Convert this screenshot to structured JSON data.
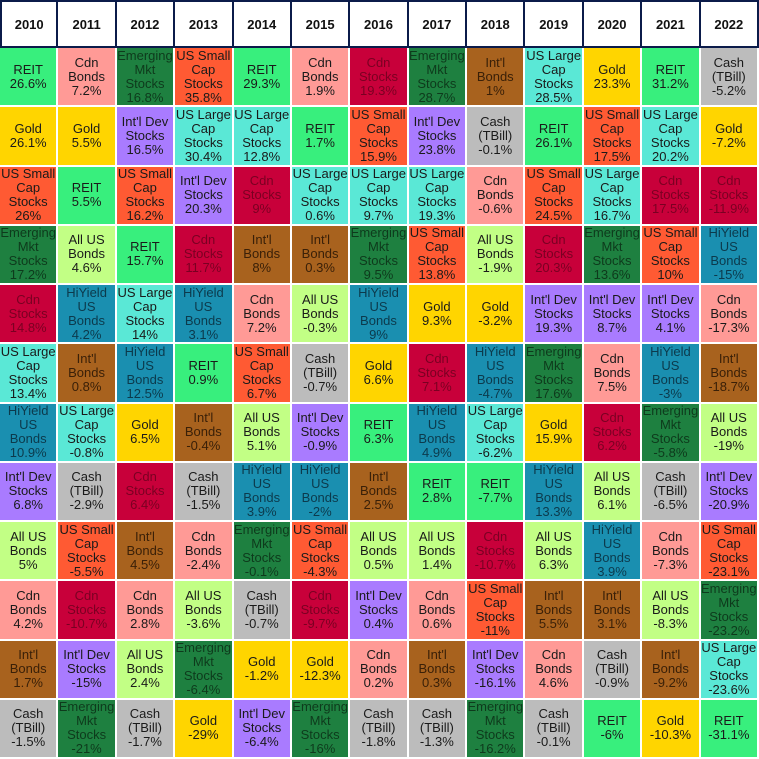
{
  "chart_data": {
    "type": "table",
    "title": "",
    "years": [
      "2010",
      "2011",
      "2012",
      "2013",
      "2014",
      "2015",
      "2016",
      "2017",
      "2018",
      "2019",
      "2020",
      "2021",
      "2022"
    ],
    "asset_colors": {
      "REIT": "#38ef7d",
      "Cdn Bonds": "#ff9a96",
      "Emerging Mkt Stocks": "#1e8040",
      "US Small Cap Stocks": "#ff5a33",
      "Cdn Stocks": "#c8003a",
      "Int'l Bonds": "#a8621e",
      "Gold": "#ffd500",
      "Int'l Dev Stocks": "#a97bff",
      "US Large Cap Stocks": "#5ae8d6",
      "Cash (TBill)": "#bcbcbc",
      "All US Bonds": "#c2ff85",
      "HiYield US Bonds": "#1a8fb0"
    },
    "asset_labels": {
      "REIT": "REIT",
      "Cdn Bonds": "Cdn\nBonds",
      "Emerging Mkt Stocks": "Emerging\nMkt\nStocks",
      "US Small Cap Stocks": "US Small\nCap\nStocks",
      "Cdn Stocks": "Cdn\nStocks",
      "Int'l Bonds": "Int'l\nBonds",
      "Gold": "Gold",
      "Int'l Dev Stocks": "Int'l Dev\nStocks",
      "US Large Cap Stocks": "US Large\nCap\nStocks",
      "Cash (TBill)": "Cash\n(TBill)",
      "All US Bonds": "All US\nBonds",
      "HiYield US Bonds": "HiYield\nUS\nBonds"
    },
    "columns": [
      {
        "year": "2010",
        "cells": [
          [
            "REIT",
            "26.6%"
          ],
          [
            "Gold",
            "26.1%"
          ],
          [
            "US Small Cap Stocks",
            "26%"
          ],
          [
            "Emerging Mkt Stocks",
            "17.2%"
          ],
          [
            "Cdn Stocks",
            "14.8%"
          ],
          [
            "US Large Cap Stocks",
            "13.4%"
          ],
          [
            "HiYield US Bonds",
            "10.9%"
          ],
          [
            "Int'l Dev Stocks",
            "6.8%"
          ],
          [
            "All US Bonds",
            "5%"
          ],
          [
            "Cdn Bonds",
            "4.2%"
          ],
          [
            "Int'l Bonds",
            "1.7%"
          ],
          [
            "Cash (TBill)",
            "-1.5%"
          ]
        ]
      },
      {
        "year": "2011",
        "cells": [
          [
            "Cdn Bonds",
            "7.2%"
          ],
          [
            "Gold",
            "5.5%"
          ],
          [
            "REIT",
            "5.5%"
          ],
          [
            "All US Bonds",
            "4.6%"
          ],
          [
            "HiYield US Bonds",
            "4.2%"
          ],
          [
            "Int'l Bonds",
            "0.8%"
          ],
          [
            "US Large Cap Stocks",
            "-0.8%"
          ],
          [
            "Cash (TBill)",
            "-2.9%"
          ],
          [
            "US Small Cap Stocks",
            "-5.5%"
          ],
          [
            "Cdn Stocks",
            "-10.7%"
          ],
          [
            "Int'l Dev Stocks",
            "-15%"
          ],
          [
            "Emerging Mkt Stocks",
            "-21%"
          ]
        ]
      },
      {
        "year": "2012",
        "cells": [
          [
            "Emerging Mkt Stocks",
            "16.8%"
          ],
          [
            "Int'l Dev Stocks",
            "16.5%"
          ],
          [
            "US Small Cap Stocks",
            "16.2%"
          ],
          [
            "REIT",
            "15.7%"
          ],
          [
            "US Large Cap Stocks",
            "14%"
          ],
          [
            "HiYield US Bonds",
            "12.5%"
          ],
          [
            "Gold",
            "6.5%"
          ],
          [
            "Cdn Stocks",
            "6.4%"
          ],
          [
            "Int'l Bonds",
            "4.5%"
          ],
          [
            "Cdn Bonds",
            "2.8%"
          ],
          [
            "All US Bonds",
            "2.4%"
          ],
          [
            "Cash (TBill)",
            "-1.7%"
          ]
        ]
      },
      {
        "year": "2013",
        "cells": [
          [
            "US Small Cap Stocks",
            "35.8%"
          ],
          [
            "US Large Cap Stocks",
            "30.4%"
          ],
          [
            "Int'l Dev Stocks",
            "20.3%"
          ],
          [
            "Cdn Stocks",
            "11.7%"
          ],
          [
            "HiYield US Bonds",
            "3.1%"
          ],
          [
            "REIT",
            "0.9%"
          ],
          [
            "Int'l Bonds",
            "-0.4%"
          ],
          [
            "Cash (TBill)",
            "-1.5%"
          ],
          [
            "Cdn Bonds",
            "-2.4%"
          ],
          [
            "All US Bonds",
            "-3.6%"
          ],
          [
            "Emerging Mkt Stocks",
            "-6.4%"
          ],
          [
            "Gold",
            "-29%"
          ]
        ]
      },
      {
        "year": "2014",
        "cells": [
          [
            "REIT",
            "29.3%"
          ],
          [
            "US Large Cap Stocks",
            "12.8%"
          ],
          [
            "Cdn Stocks",
            "9%"
          ],
          [
            "Int'l Bonds",
            "8%"
          ],
          [
            "Cdn Bonds",
            "7.2%"
          ],
          [
            "US Small Cap Stocks",
            "6.7%"
          ],
          [
            "All US Bonds",
            "5.1%"
          ],
          [
            "HiYield US Bonds",
            "3.9%"
          ],
          [
            "Emerging Mkt Stocks",
            "-0.1%"
          ],
          [
            "Cash (TBill)",
            "-0.7%"
          ],
          [
            "Gold",
            "-1.2%"
          ],
          [
            "Int'l Dev Stocks",
            "-6.4%"
          ]
        ]
      },
      {
        "year": "2015",
        "cells": [
          [
            "Cdn Bonds",
            "1.9%"
          ],
          [
            "REIT",
            "1.7%"
          ],
          [
            "US Large Cap Stocks",
            "0.6%"
          ],
          [
            "Int'l Bonds",
            "0.3%"
          ],
          [
            "All US Bonds",
            "-0.3%"
          ],
          [
            "Cash (TBill)",
            "-0.7%"
          ],
          [
            "Int'l Dev Stocks",
            "-0.9%"
          ],
          [
            "HiYield US Bonds",
            "-2%"
          ],
          [
            "US Small Cap Stocks",
            "-4.3%"
          ],
          [
            "Cdn Stocks",
            "-9.7%"
          ],
          [
            "Gold",
            "-12.3%"
          ],
          [
            "Emerging Mkt Stocks",
            "-16%"
          ]
        ]
      },
      {
        "year": "2016",
        "cells": [
          [
            "Cdn Stocks",
            "19.3%"
          ],
          [
            "US Small Cap Stocks",
            "15.9%"
          ],
          [
            "US Large Cap Stocks",
            "9.7%"
          ],
          [
            "Emerging Mkt Stocks",
            "9.5%"
          ],
          [
            "HiYield US Bonds",
            "9%"
          ],
          [
            "Gold",
            "6.6%"
          ],
          [
            "REIT",
            "6.3%"
          ],
          [
            "Int'l Bonds",
            "2.5%"
          ],
          [
            "All US Bonds",
            "0.5%"
          ],
          [
            "Int'l Dev Stocks",
            "0.4%"
          ],
          [
            "Cdn Bonds",
            "0.2%"
          ],
          [
            "Cash (TBill)",
            "-1.8%"
          ]
        ]
      },
      {
        "year": "2017",
        "cells": [
          [
            "Emerging Mkt Stocks",
            "28.7%"
          ],
          [
            "Int'l Dev Stocks",
            "23.8%"
          ],
          [
            "US Large Cap Stocks",
            "19.3%"
          ],
          [
            "US Small Cap Stocks",
            "13.8%"
          ],
          [
            "Gold",
            "9.3%"
          ],
          [
            "Cdn Stocks",
            "7.1%"
          ],
          [
            "HiYield US Bonds",
            "4.9%"
          ],
          [
            "REIT",
            "2.8%"
          ],
          [
            "All US Bonds",
            "1.4%"
          ],
          [
            "Cdn Bonds",
            "0.6%"
          ],
          [
            "Int'l Bonds",
            "0.3%"
          ],
          [
            "Cash (TBill)",
            "-1.3%"
          ]
        ]
      },
      {
        "year": "2018",
        "cells": [
          [
            "Int'l Bonds",
            "1%"
          ],
          [
            "Cash (TBill)",
            "-0.1%"
          ],
          [
            "Cdn Bonds",
            "-0.6%"
          ],
          [
            "All US Bonds",
            "-1.9%"
          ],
          [
            "Gold",
            "-3.2%"
          ],
          [
            "HiYield US Bonds",
            "-4.7%"
          ],
          [
            "US Large Cap Stocks",
            "-6.2%"
          ],
          [
            "REIT",
            "-7.7%"
          ],
          [
            "Cdn Stocks",
            "-10.7%"
          ],
          [
            "US Small Cap Stocks",
            "-11%"
          ],
          [
            "Int'l Dev Stocks",
            "-16.1%"
          ],
          [
            "Emerging Mkt Stocks",
            "-16.2%"
          ]
        ]
      },
      {
        "year": "2019",
        "cells": [
          [
            "US Large Cap Stocks",
            "28.5%"
          ],
          [
            "REIT",
            "26.1%"
          ],
          [
            "US Small Cap Stocks",
            "24.5%"
          ],
          [
            "Cdn Stocks",
            "20.3%"
          ],
          [
            "Int'l Dev Stocks",
            "19.3%"
          ],
          [
            "Emerging Mkt Stocks",
            "17.6%"
          ],
          [
            "Gold",
            "15.9%"
          ],
          [
            "HiYield US Bonds",
            "13.3%"
          ],
          [
            "All US Bonds",
            "6.3%"
          ],
          [
            "Int'l Bonds",
            "5.5%"
          ],
          [
            "Cdn Bonds",
            "4.6%"
          ],
          [
            "Cash (TBill)",
            "-0.1%"
          ]
        ]
      },
      {
        "year": "2020",
        "cells": [
          [
            "Gold",
            "23.3%"
          ],
          [
            "US Small Cap Stocks",
            "17.5%"
          ],
          [
            "US Large Cap Stocks",
            "16.7%"
          ],
          [
            "Emerging Mkt Stocks",
            "13.6%"
          ],
          [
            "Int'l Dev Stocks",
            "8.7%"
          ],
          [
            "Cdn Bonds",
            "7.5%"
          ],
          [
            "Cdn Stocks",
            "6.2%"
          ],
          [
            "All US Bonds",
            "6.1%"
          ],
          [
            "HiYield US Bonds",
            "3.9%"
          ],
          [
            "Int'l Bonds",
            "3.1%"
          ],
          [
            "Cash (TBill)",
            "-0.9%"
          ],
          [
            "REIT",
            "-6%"
          ]
        ]
      },
      {
        "year": "2021",
        "cells": [
          [
            "REIT",
            "31.2%"
          ],
          [
            "US Large Cap Stocks",
            "20.2%"
          ],
          [
            "Cdn Stocks",
            "17.5%"
          ],
          [
            "US Small Cap Stocks",
            "10%"
          ],
          [
            "Int'l Dev Stocks",
            "4.1%"
          ],
          [
            "HiYield US Bonds",
            "-3%"
          ],
          [
            "Emerging Mkt Stocks",
            "-5.8%"
          ],
          [
            "Cash (TBill)",
            "-6.5%"
          ],
          [
            "Cdn Bonds",
            "-7.3%"
          ],
          [
            "All US Bonds",
            "-8.3%"
          ],
          [
            "Int'l Bonds",
            "-9.2%"
          ],
          [
            "Gold",
            "-10.3%"
          ]
        ]
      },
      {
        "year": "2022",
        "cells": [
          [
            "Cash (TBill)",
            "-5.2%"
          ],
          [
            "Gold",
            "-7.2%"
          ],
          [
            "Cdn Stocks",
            "-11.9%"
          ],
          [
            "HiYield US Bonds",
            "-15%"
          ],
          [
            "Cdn Bonds",
            "-17.3%"
          ],
          [
            "Int'l Bonds",
            "-18.7%"
          ],
          [
            "All US Bonds",
            "-19%"
          ],
          [
            "Int'l Dev Stocks",
            "-20.9%"
          ],
          [
            "US Small Cap Stocks",
            "-23.1%"
          ],
          [
            "Emerging Mkt Stocks",
            "-23.2%"
          ],
          [
            "US Large Cap Stocks",
            "-23.6%"
          ],
          [
            "REIT",
            "-31.1%"
          ]
        ]
      }
    ]
  }
}
